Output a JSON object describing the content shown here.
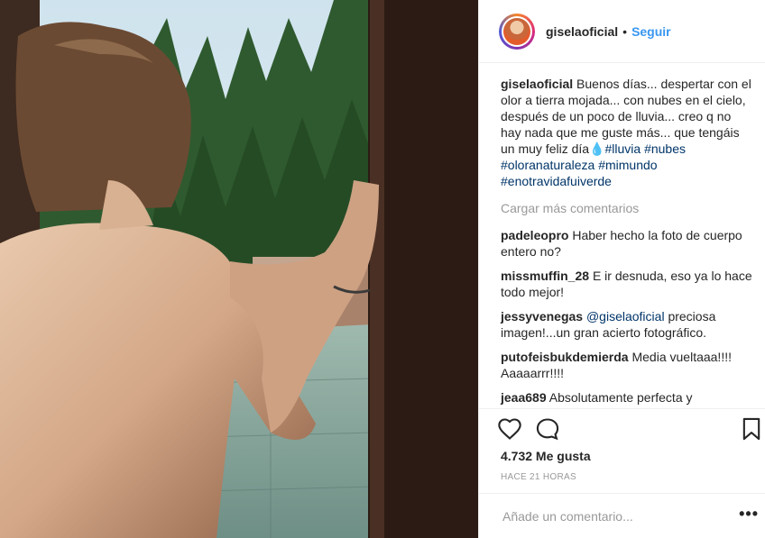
{
  "post": {
    "username": "giselaoficial",
    "follow_label": "Seguir",
    "separator": "•"
  },
  "caption": {
    "username": "giselaoficial",
    "text": "Buenos días... despertar con el olor a tierra mojada... con nubes en el cielo, después de un poco de lluvia... creo q no hay nada que me guste más... que tengáis un muy feliz día💧",
    "hashtags": [
      "#lluvia",
      "#nubes",
      "#oloranaturaleza",
      "#mimundo",
      "#enotravidafuiverde"
    ]
  },
  "load_more": "Cargar más comentarios",
  "comments": [
    {
      "user": "padeleopro",
      "text": "Haber hecho la foto de cuerpo entero no?"
    },
    {
      "user": "missmuffin_28",
      "text": "E ir desnuda, eso ya lo hace todo mejor!"
    },
    {
      "user": "jessyvenegas",
      "mention": "@giselaoficial",
      "text": " preciosa imagen!...un gran acierto fotográfico."
    },
    {
      "user": "putofeisbukdemierda",
      "text": "Media vueltaaa!!!! Aaaaarrr!!!!"
    },
    {
      "user": "jeaa689",
      "text": "Absolutamente perfecta y preciosa.....la fotografía también"
    }
  ],
  "actions": {
    "like_icon": "heart-icon",
    "comment_icon": "comment-bubble-icon",
    "save_icon": "bookmark-icon"
  },
  "likes": "4.732 Me gusta",
  "timestamp": "HACE 21 HORAS",
  "add_comment": {
    "placeholder": "Añade un comentario...",
    "options_label": "•••"
  },
  "colors": {
    "link_blue": "#3897f0",
    "hashtag_blue": "#003569",
    "muted": "#999999",
    "text": "#262626"
  }
}
